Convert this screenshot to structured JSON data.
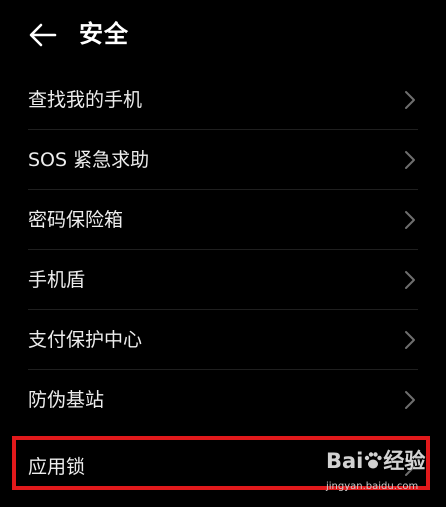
{
  "header": {
    "title": "安全",
    "back_icon": "arrow-left-icon"
  },
  "menu": {
    "items": [
      {
        "label": "查找我的手机"
      },
      {
        "label": "SOS 紧急求助"
      },
      {
        "label": "密码保险箱"
      },
      {
        "label": "手机盾"
      },
      {
        "label": "支付保护中心"
      },
      {
        "label": "防伪基站"
      }
    ],
    "highlighted_item": {
      "label": "应用锁"
    }
  },
  "annotation": {
    "highlight_color": "#e1191b"
  },
  "watermark": {
    "logo_left": "Bai",
    "logo_right": "经验",
    "url": "jingyan.baidu.com"
  },
  "colors": {
    "background": "#000000",
    "text": "#ededed",
    "chevron": "#6e6e6e",
    "divider": "#1f1f1f"
  }
}
